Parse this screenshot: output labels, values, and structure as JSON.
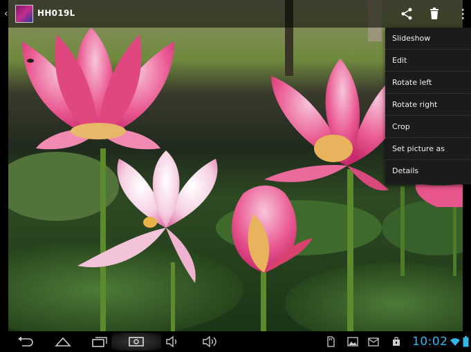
{
  "header": {
    "album_title": "HH019L",
    "icons": [
      "back-chevron-icon",
      "album-thumbnail",
      "share-icon",
      "delete-icon",
      "overflow-menu-icon"
    ]
  },
  "menu": {
    "items": [
      {
        "label": "Slideshow"
      },
      {
        "label": "Edit"
      },
      {
        "label": "Rotate left"
      },
      {
        "label": "Rotate right"
      },
      {
        "label": "Crop"
      },
      {
        "label": "Set picture as"
      },
      {
        "label": "Details"
      }
    ]
  },
  "status": {
    "time": "10:02",
    "icons": [
      "back-icon",
      "home-icon",
      "recent-apps-icon",
      "screenshot-icon",
      "volume-down-icon",
      "volume-up-icon",
      "sd-card-icon",
      "gallery-notification-icon",
      "email-icon",
      "usb-icon",
      "wifi-icon",
      "battery-icon"
    ]
  },
  "colors": {
    "clock": "#33b5e5",
    "menu_background": "#1b1b1b",
    "petal_pink": "#e8417f"
  }
}
